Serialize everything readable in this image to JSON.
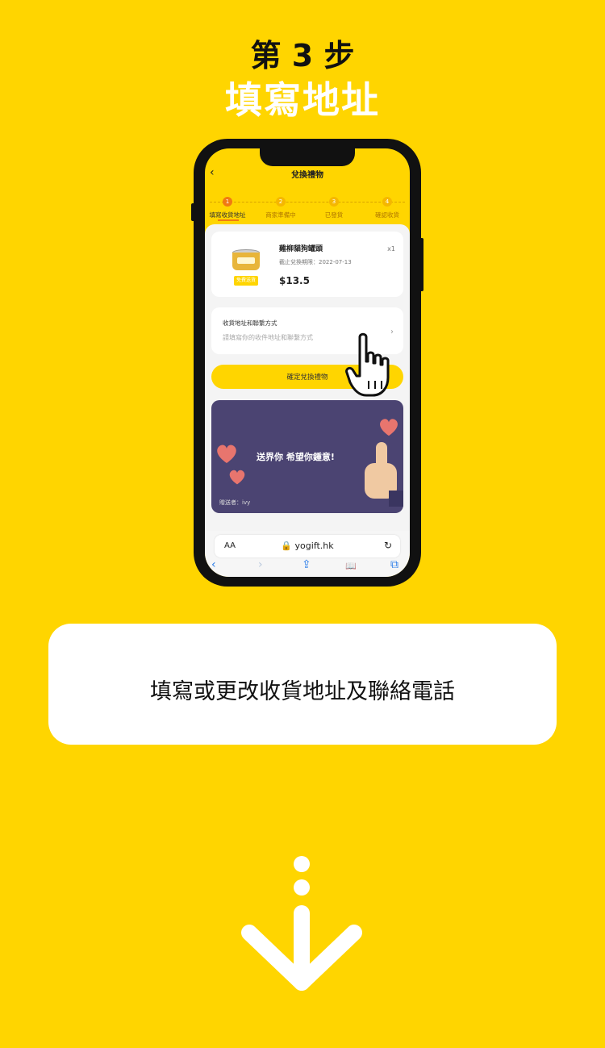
{
  "step": {
    "number": "第 3 步",
    "title": "填寫地址"
  },
  "phone": {
    "nav": {
      "back_icon": "‹",
      "title": "兌換禮物"
    },
    "progress": {
      "steps": [
        {
          "num": "1",
          "label": "填寫收貨地址",
          "active": true
        },
        {
          "num": "2",
          "label": "商家準備中",
          "active": false
        },
        {
          "num": "3",
          "label": "已發貨",
          "active": false
        },
        {
          "num": "4",
          "label": "確認收貨",
          "active": false
        }
      ]
    },
    "product": {
      "name": "雞柳貓狗罐頭",
      "deadline": "截止兌換期限：2022-07-13",
      "price": "$13.5",
      "qty": "x1",
      "tag": "免費送貨"
    },
    "address": {
      "label": "收貨地址和聯繫方式",
      "placeholder": "請填寫你的收件地址和聯繫方式",
      "chevron": "›"
    },
    "confirm_button": "確定兌換禮物",
    "gift": {
      "message": "送界你 希望你鍾意!",
      "from": "贈送者：ivy"
    },
    "browser": {
      "aa": "AA",
      "url": "🔒 yogift.hk",
      "reload": "↻",
      "toolbar": {
        "back": "‹",
        "forward": "›",
        "share": "⇪",
        "bookmarks": "📖",
        "tabs": "⧉"
      }
    }
  },
  "caption": "填寫或更改收貨地址及聯絡電話",
  "colors": {
    "background": "#FFD500",
    "accent": "#F07A12",
    "gift_card": "#4B4472"
  }
}
